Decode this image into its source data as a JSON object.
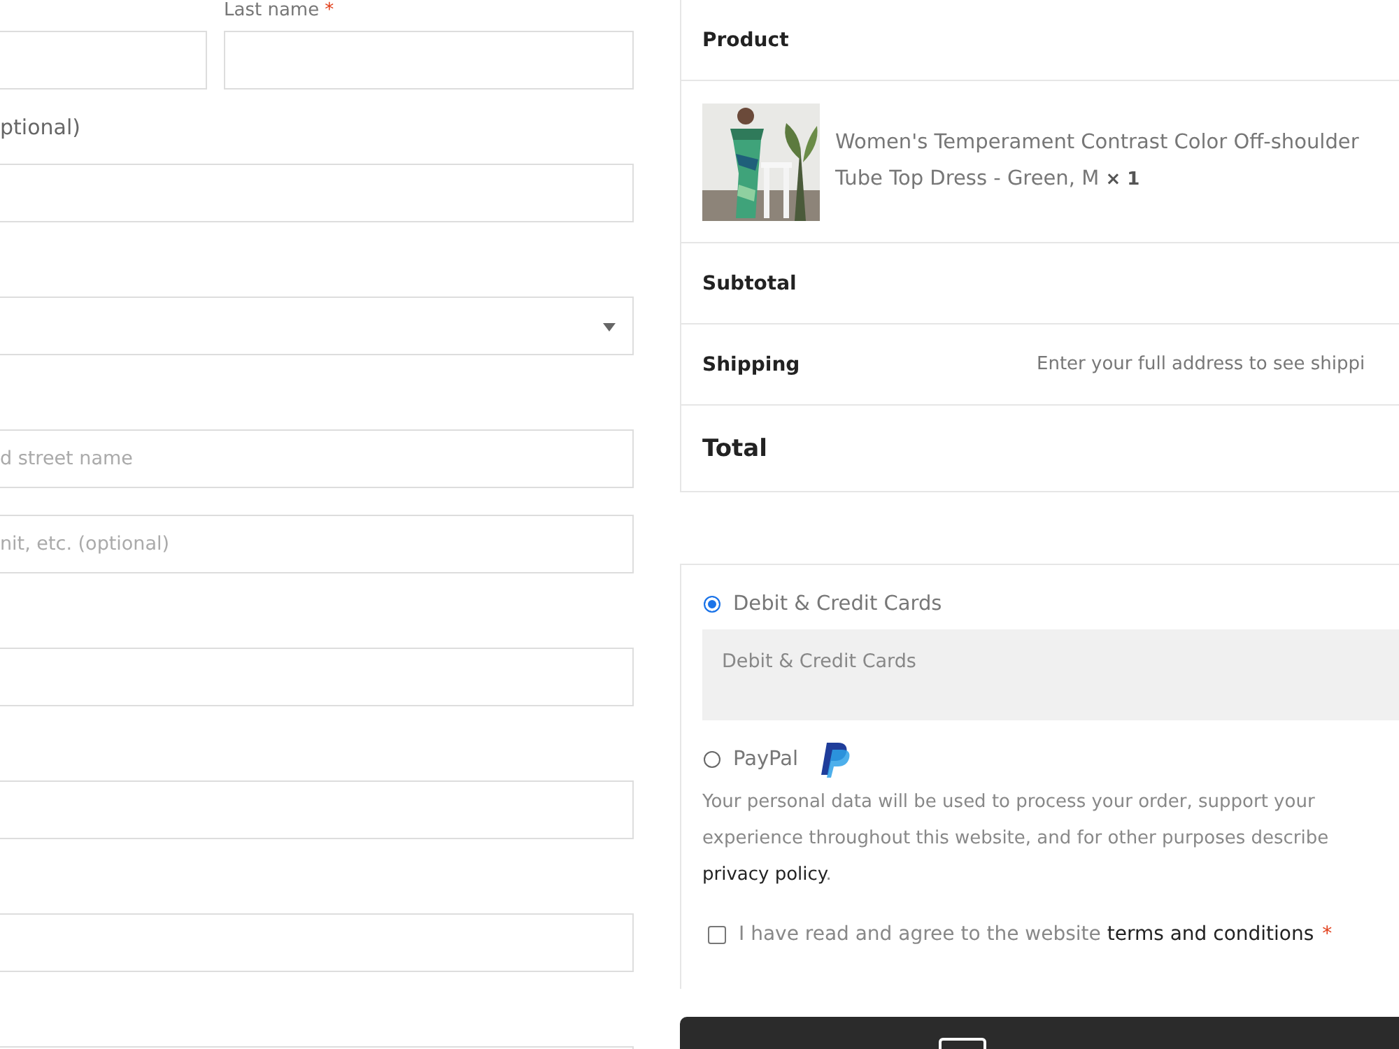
{
  "billing": {
    "name_fields": [
      {
        "kind": "text"
      },
      {
        "kind": "text",
        "label": "Last name",
        "required_mark": "*"
      }
    ],
    "fields": [
      {
        "kind": "text",
        "label": "ptional)"
      },
      {
        "kind": "select"
      },
      {
        "kind": "text",
        "placeholder": "d street name"
      },
      {
        "kind": "address2",
        "placeholder": "nit, etc. (optional)"
      },
      {
        "kind": "text"
      },
      {
        "kind": "text"
      },
      {
        "kind": "text"
      },
      {
        "kind": "text"
      }
    ]
  },
  "order": {
    "header": "Product",
    "product": {
      "name": "Women's Temperament Contrast Color Off-shoulder Tube Top Dress - Green, M",
      "quantity": "× 1"
    },
    "rows": [
      {
        "kind": "plain",
        "label": "Subtotal"
      },
      {
        "kind": "plain",
        "label": "Shipping",
        "value": "Enter your full address to see shippi"
      },
      {
        "kind": "total",
        "label": "Total"
      }
    ]
  },
  "payment": {
    "methods": [
      {
        "label": "Debit & Credit Cards",
        "selected": true,
        "description": "Debit & Credit Cards",
        "has_logo": false
      },
      {
        "label": "PayPal",
        "selected": false,
        "has_logo": true
      }
    ],
    "privacy_lines": [
      "Your personal data will be used to process your order, support your",
      "experience throughout this website, and for other purposes describe"
    ],
    "privacy_link": "privacy policy",
    "privacy_end": ".",
    "terms": {
      "text": "I have read and agree to the website",
      "link": "terms and conditions",
      "required_mark": "*",
      "checked": false
    }
  }
}
